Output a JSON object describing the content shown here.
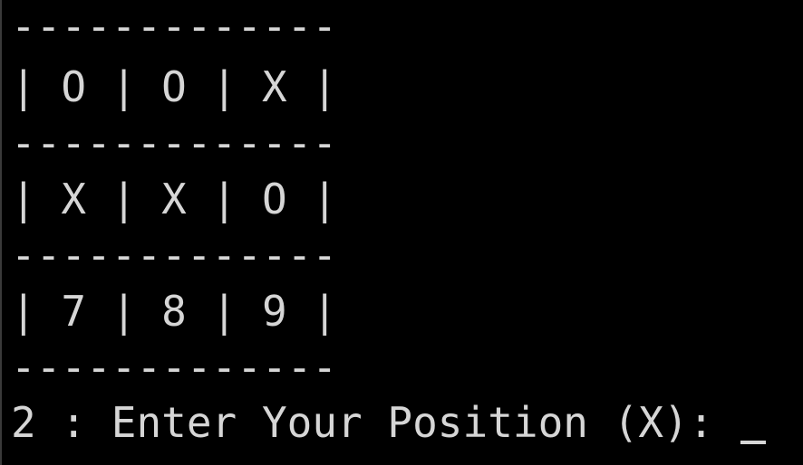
{
  "terminal": {
    "lines": [
      "-------------",
      "| O | O | X |",
      "-------------",
      "| X | X | O |",
      "-------------",
      "| 7 | 8 | 9 |",
      "-------------"
    ],
    "prompt": "2 : Enter Your Position (X): ",
    "colors": {
      "background": "#000000",
      "text": "#d6d6d6"
    }
  }
}
